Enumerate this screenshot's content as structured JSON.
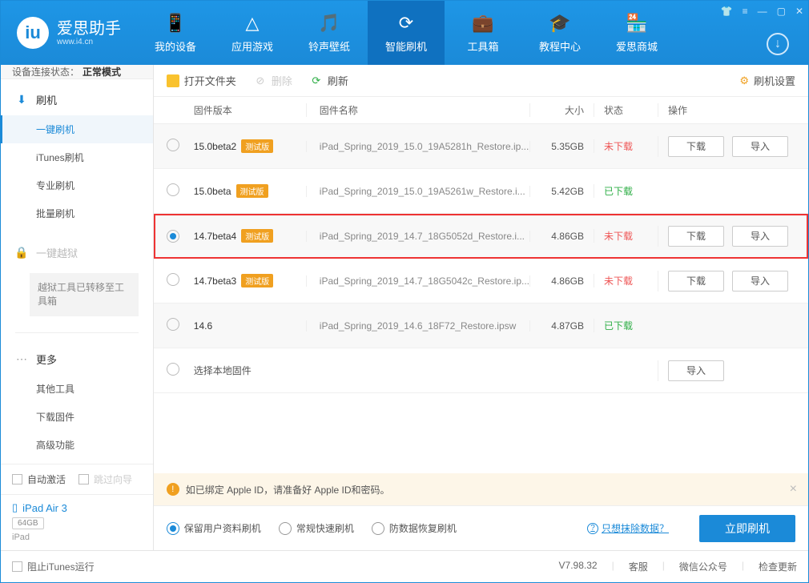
{
  "app": {
    "name": "爱思助手",
    "domain": "www.i4.cn"
  },
  "nav": [
    {
      "label": "我的设备",
      "icon": "📱"
    },
    {
      "label": "应用游戏",
      "icon": "△"
    },
    {
      "label": "铃声壁纸",
      "icon": "🎵"
    },
    {
      "label": "智能刷机",
      "icon": "⟳",
      "active": true
    },
    {
      "label": "工具箱",
      "icon": "💼"
    },
    {
      "label": "教程中心",
      "icon": "🎓"
    },
    {
      "label": "爱思商城",
      "icon": "🏪"
    }
  ],
  "status": {
    "label": "设备连接状态：",
    "value": "正常模式"
  },
  "sidebar": {
    "flash": {
      "title": "刷机",
      "items": [
        "一键刷机",
        "iTunes刷机",
        "专业刷机",
        "批量刷机"
      ]
    },
    "jailbreak": {
      "title": "一键越狱",
      "note": "越狱工具已转移至工具箱"
    },
    "more": {
      "title": "更多",
      "items": [
        "其他工具",
        "下载固件",
        "高级功能"
      ]
    },
    "autoActivate": "自动激活",
    "skipGuide": "跳过向导",
    "device": {
      "name": "iPad Air 3",
      "storage": "64GB",
      "type": "iPad"
    }
  },
  "toolbar": {
    "openFolder": "打开文件夹",
    "delete": "删除",
    "refresh": "刷新",
    "settings": "刷机设置"
  },
  "tableHead": {
    "version": "固件版本",
    "name": "固件名称",
    "size": "大小",
    "status": "状态",
    "action": "操作"
  },
  "rows": [
    {
      "version": "15.0beta2",
      "beta": true,
      "file": "iPad_Spring_2019_15.0_19A5281h_Restore.ip...",
      "size": "5.35GB",
      "status": "未下载",
      "statusClass": "red",
      "download": true,
      "import": true,
      "selected": false
    },
    {
      "version": "15.0beta",
      "beta": true,
      "file": "iPad_Spring_2019_15.0_19A5261w_Restore.i...",
      "size": "5.42GB",
      "status": "已下载",
      "statusClass": "green",
      "download": false,
      "import": false,
      "selected": false
    },
    {
      "version": "14.7beta4",
      "beta": true,
      "file": "iPad_Spring_2019_14.7_18G5052d_Restore.i...",
      "size": "4.86GB",
      "status": "未下载",
      "statusClass": "red",
      "download": true,
      "import": true,
      "selected": true,
      "highlight": true
    },
    {
      "version": "14.7beta3",
      "beta": true,
      "file": "iPad_Spring_2019_14.7_18G5042c_Restore.ip...",
      "size": "4.86GB",
      "status": "未下载",
      "statusClass": "red",
      "download": true,
      "import": true,
      "selected": false
    },
    {
      "version": "14.6",
      "beta": false,
      "file": "iPad_Spring_2019_14.6_18F72_Restore.ipsw",
      "size": "4.87GB",
      "status": "已下载",
      "statusClass": "green",
      "download": false,
      "import": false,
      "selected": false
    }
  ],
  "localRow": {
    "label": "选择本地固件",
    "import": "导入"
  },
  "actions": {
    "download": "下载",
    "import": "导入"
  },
  "betaTag": "测试版",
  "warn": "如已绑定 Apple ID，请准备好 Apple ID和密码。",
  "options": {
    "keep": "保留用户资料刷机",
    "normal": "常规快速刷机",
    "antiloss": "防数据恢复刷机",
    "eraseLink": "只想抹除数据？",
    "flashNow": "立即刷机"
  },
  "footer": {
    "blockItunes": "阻止iTunes运行",
    "version": "V7.98.32",
    "service": "客服",
    "wechat": "微信公众号",
    "update": "检查更新"
  }
}
